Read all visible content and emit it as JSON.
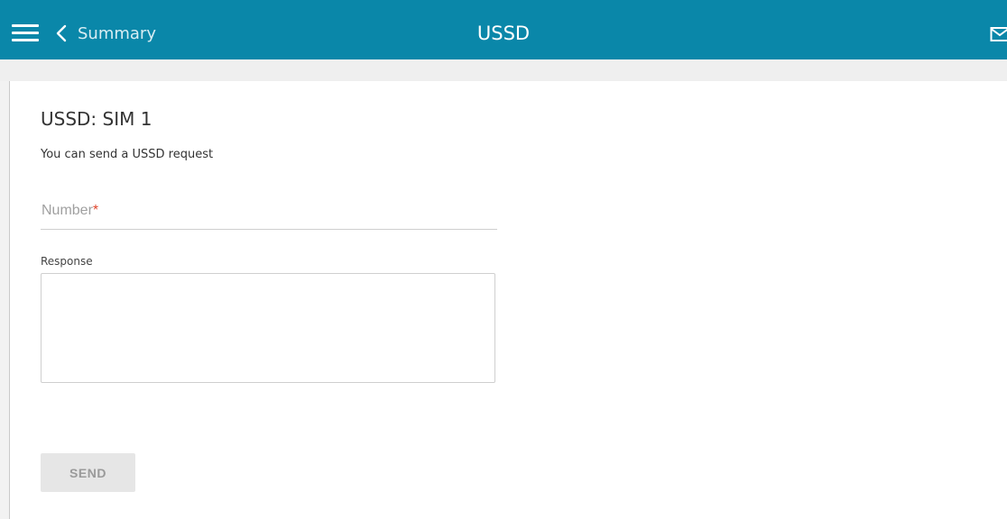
{
  "header": {
    "back_label": "Summary",
    "title": "USSD",
    "icons": {
      "menu": "hamburger-menu-icon",
      "back": "chevron-left-icon",
      "mail": "mail-icon"
    },
    "colors": {
      "bar": "#0a87a9",
      "text": "#ffffff"
    }
  },
  "section": {
    "title": "USSD: SIM 1",
    "description": "You can send a USSD request"
  },
  "form": {
    "number": {
      "placeholder": "Number",
      "required_mark": "*",
      "value": ""
    },
    "response": {
      "label": "Response",
      "value": ""
    },
    "send_label": "SEND"
  }
}
